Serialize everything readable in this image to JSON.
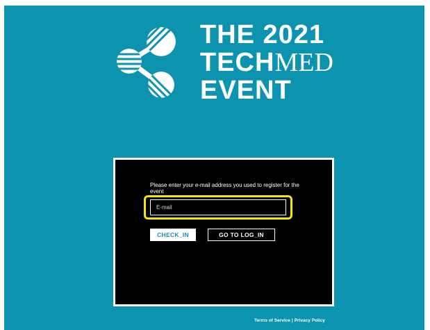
{
  "brand": {
    "logo": "share-nodes-logo-icon",
    "title_lines": [
      "THE 2021",
      "TECH",
      "MED",
      "EVENT"
    ]
  },
  "login": {
    "instruction": "Please enter your e-mail address you used to register for the event",
    "email_placeholder": "E-mail",
    "email_value": "",
    "checkin_label": "CHECK_IN",
    "goto_login_label": "GO TO LOG_IN"
  },
  "footer": {
    "terms_label": "Terms of Service",
    "separator": "|",
    "privacy_label": "Privacy Policy"
  },
  "colors": {
    "background": "#0c93af",
    "panel": "#000000",
    "highlight": "#f5e800",
    "text": "#ffffff"
  }
}
